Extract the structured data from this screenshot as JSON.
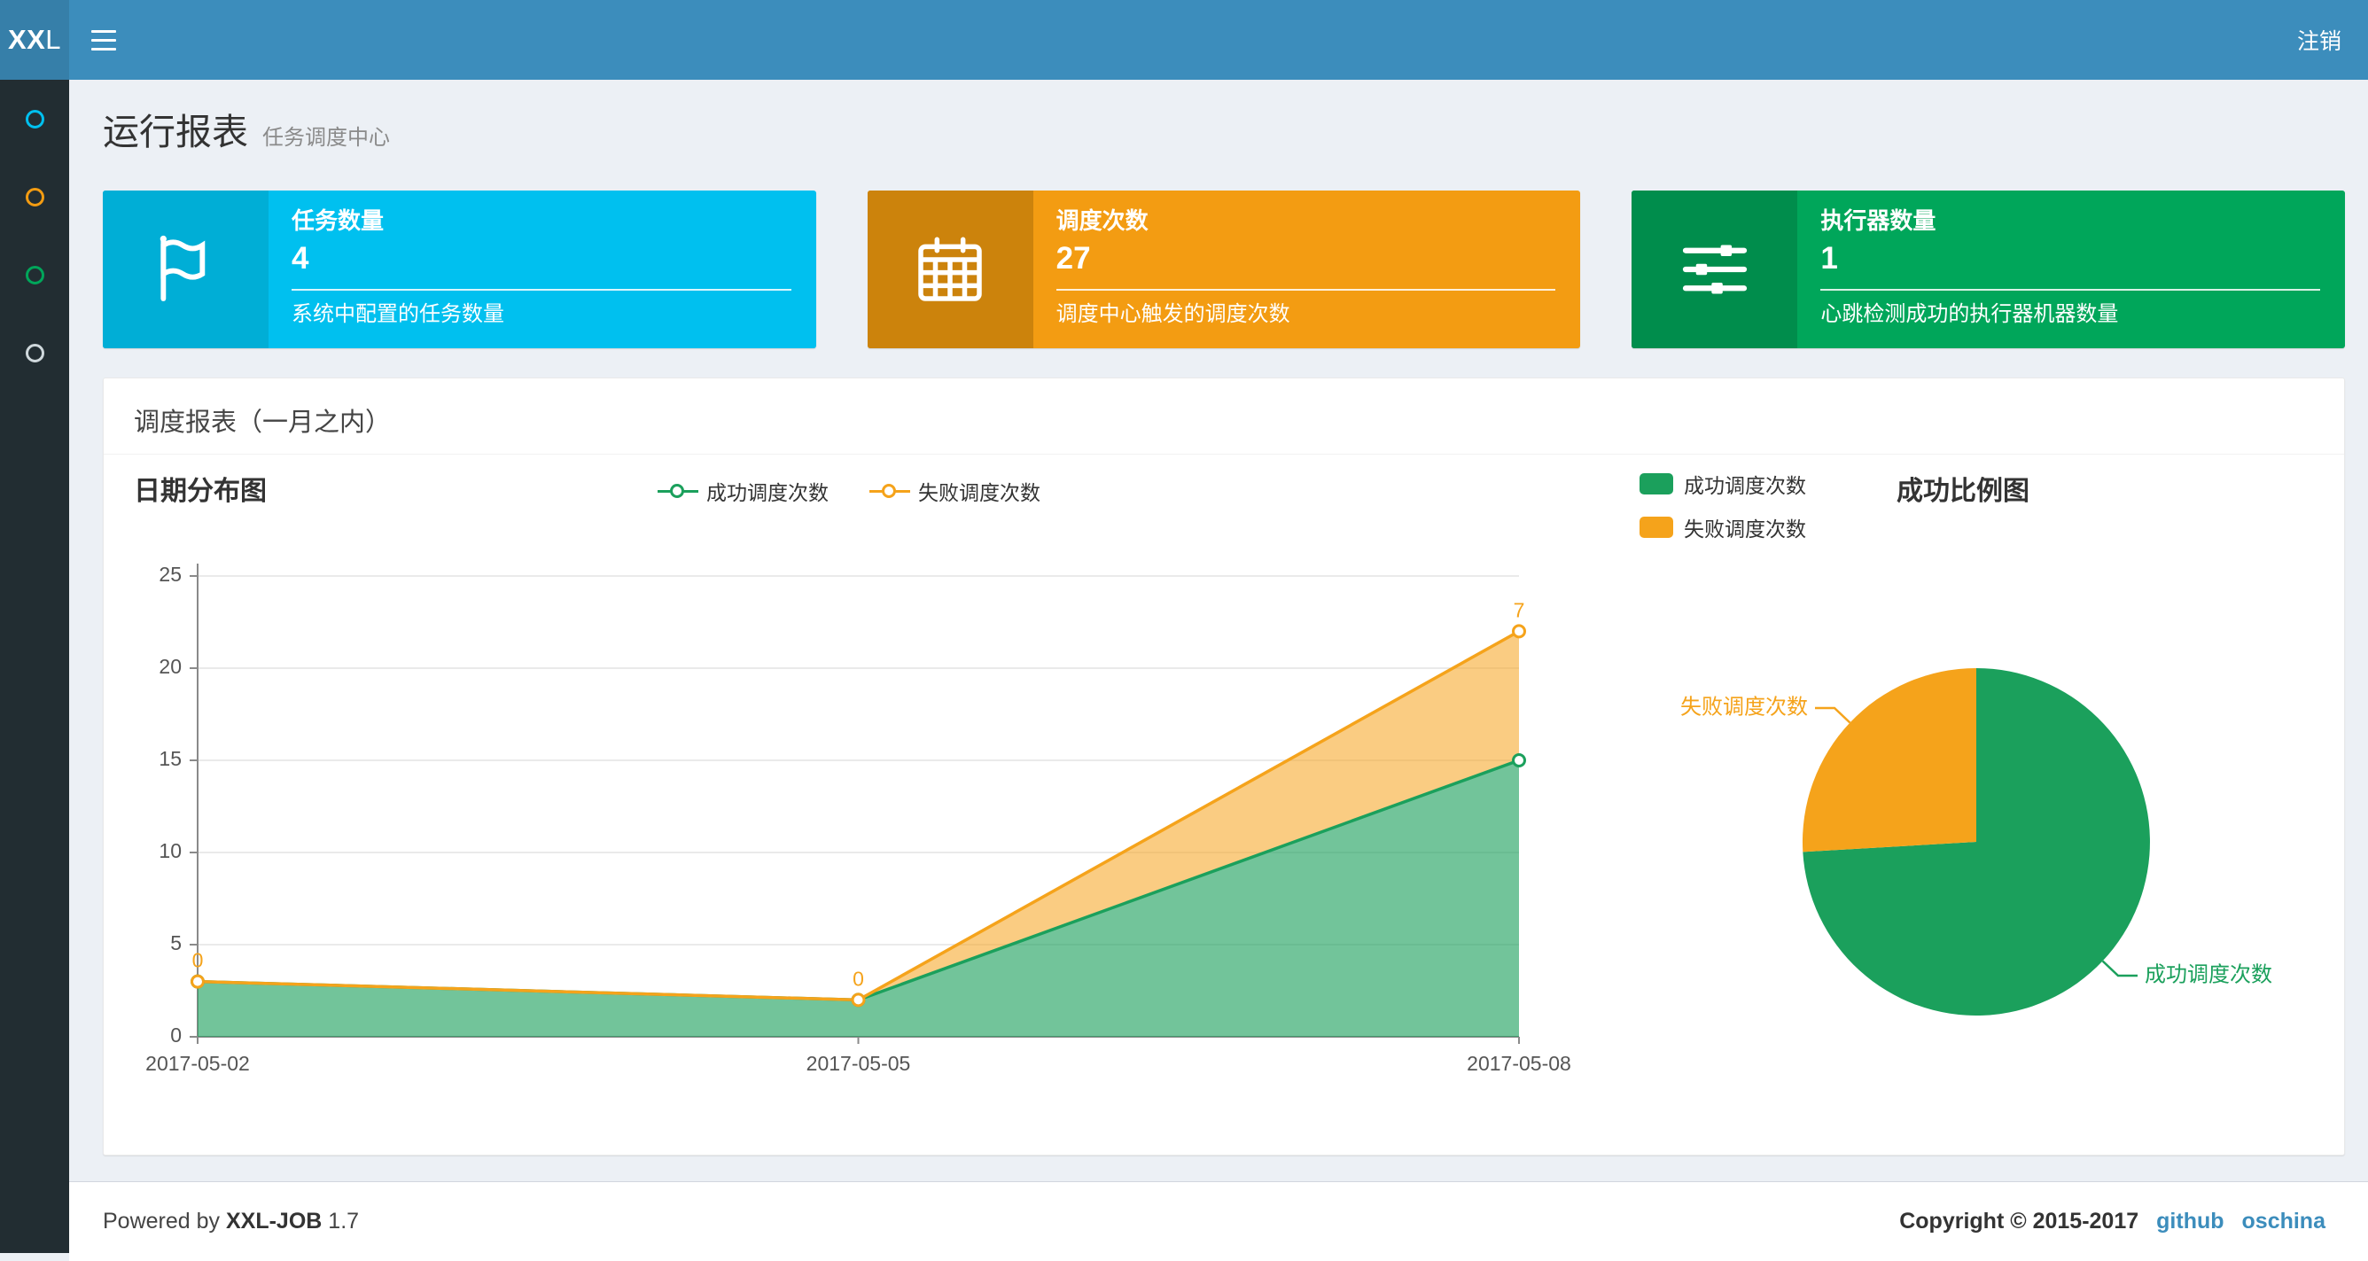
{
  "navbar": {
    "bg": "#3c8dbc",
    "logo_bg": "#367fa9",
    "logo_bold": "XX",
    "logo_light": "L",
    "logout_label": "注销"
  },
  "sidebar": {
    "bg": "#222d32",
    "items": [
      {
        "icon": "circle-outline-icon",
        "color": "#00c0ef"
      },
      {
        "icon": "circle-outline-icon",
        "color": "#f39c12"
      },
      {
        "icon": "circle-outline-icon",
        "color": "#00a65a"
      },
      {
        "icon": "circle-outline-icon",
        "color": "#cfd8dc"
      }
    ]
  },
  "page_header": {
    "title": "运行报表",
    "subtitle": "任务调度中心"
  },
  "info_boxes": [
    {
      "icon": "flag-icon",
      "label": "任务数量",
      "value": "4",
      "desc": "系统中配置的任务数量",
      "bg": "#00c0ef",
      "icon_bg": "#00aed6"
    },
    {
      "icon": "calendar-icon",
      "label": "调度次数",
      "value": "27",
      "desc": "调度中心触发的调度次数",
      "bg": "#f39c12",
      "icon_bg": "#cc830c"
    },
    {
      "icon": "sliders-icon",
      "label": "执行器数量",
      "value": "1",
      "desc": "心跳检测成功的执行器机器数量",
      "bg": "#00a65a",
      "icon_bg": "#008d4c"
    }
  ],
  "panel": {
    "title": "调度报表（一月之内）"
  },
  "chart_data": [
    {
      "type": "area",
      "title": "日期分布图",
      "x": [
        "2017-05-02",
        "2017-05-05",
        "2017-05-08"
      ],
      "series": [
        {
          "name": "成功调度次数",
          "values": [
            3,
            2,
            15
          ],
          "color": "#1ba05c",
          "fill": "rgba(27,160,92,0.62)",
          "stacked": true
        },
        {
          "name": "失败调度次数",
          "values": [
            0,
            0,
            7
          ],
          "color": "#f5a31b",
          "fill": "rgba(245,163,27,0.55)",
          "stacked": true,
          "labels": [
            "0",
            "0",
            "7"
          ]
        }
      ],
      "ylim": [
        0,
        25
      ],
      "yticks": [
        0,
        5,
        10,
        15,
        20,
        25
      ],
      "grid": true,
      "legend_position": "top-center"
    },
    {
      "type": "pie",
      "title": "成功比例图",
      "slices": [
        {
          "name": "成功调度次数",
          "value": 20,
          "color": "#1ba05c"
        },
        {
          "name": "失败调度次数",
          "value": 7,
          "color": "#f5a31b"
        }
      ],
      "legend_position": "top-left"
    }
  ],
  "footer": {
    "powered_prefix": "Powered by",
    "product": "XXL-JOB",
    "version": "1.7",
    "copyright": "Copyright © 2015-2017",
    "links": [
      {
        "label": "github"
      },
      {
        "label": "oschina"
      }
    ],
    "link_color": "#3c8dbc"
  }
}
